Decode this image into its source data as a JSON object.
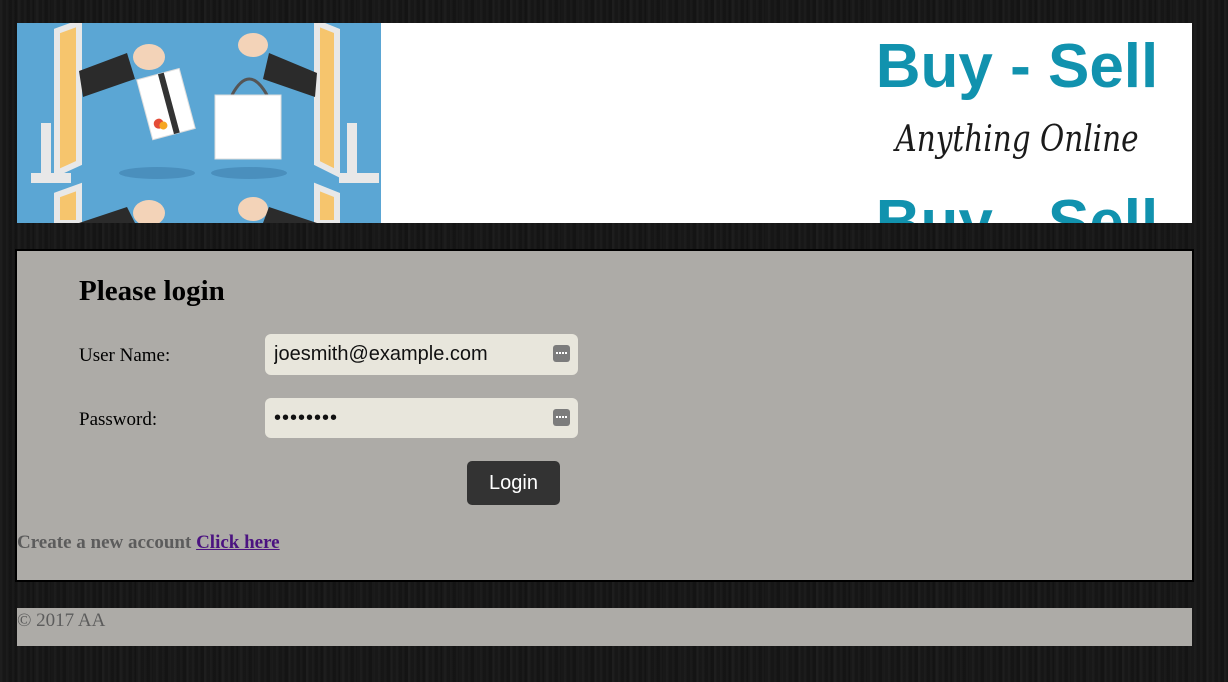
{
  "banner": {
    "title": "Buy - Sell",
    "subtitle": "Anything Online",
    "title_repeat": "Buy - Sell",
    "art_color": "#5ba6d4",
    "brand_color": "#1192ae"
  },
  "login": {
    "heading": "Please login",
    "username_label": "User Name:",
    "username_value": "joesmith@example.com",
    "password_label": "Password:",
    "password_value": "password",
    "field_icon": "password-manager-key-icon",
    "button_label": "Login",
    "create_text": "Create a new account",
    "create_link": "Click here"
  },
  "footer": {
    "copyright": "© 2017 AA"
  }
}
